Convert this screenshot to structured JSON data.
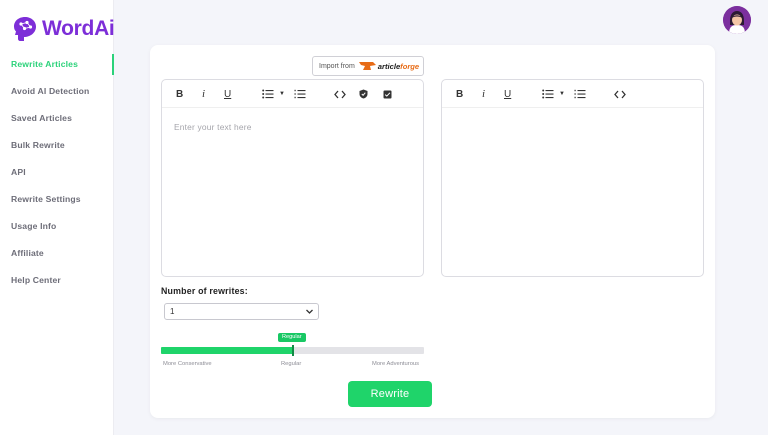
{
  "app": {
    "name": "WordAi",
    "brand_color": "#7d2ed8",
    "accent_color": "#1fd46a"
  },
  "sidebar": {
    "items": [
      {
        "label": "Rewrite Articles",
        "active": true
      },
      {
        "label": "Avoid AI Detection",
        "active": false
      },
      {
        "label": "Saved Articles",
        "active": false
      },
      {
        "label": "Bulk Rewrite",
        "active": false
      },
      {
        "label": "API",
        "active": false
      },
      {
        "label": "Rewrite Settings",
        "active": false
      },
      {
        "label": "Usage Info",
        "active": false
      },
      {
        "label": "Affiliate",
        "active": false
      },
      {
        "label": "Help Center",
        "active": false
      }
    ]
  },
  "import": {
    "label": "Import from",
    "brand_article": "article",
    "brand_forge": "forge"
  },
  "editor_left": {
    "toolbar": [
      "bold-icon",
      "italic-icon",
      "underline-icon",
      "bullet-list-icon",
      "dropdown-caret-icon",
      "numbered-list-icon",
      "code-icon",
      "shield-icon",
      "check-box-icon"
    ],
    "placeholder": "Enter your text here",
    "value": ""
  },
  "editor_right": {
    "toolbar": [
      "bold-icon",
      "italic-icon",
      "underline-icon",
      "bullet-list-icon",
      "dropdown-caret-icon",
      "numbered-list-icon",
      "code-icon"
    ],
    "value": ""
  },
  "rewrites": {
    "label": "Number of rewrites:",
    "selected": "1"
  },
  "slider": {
    "current_label": "Regular",
    "value_fraction": 0.5,
    "labels": [
      "More Conservative",
      "Regular",
      "More Adventurous"
    ]
  },
  "actions": {
    "rewrite_label": "Rewrite"
  }
}
